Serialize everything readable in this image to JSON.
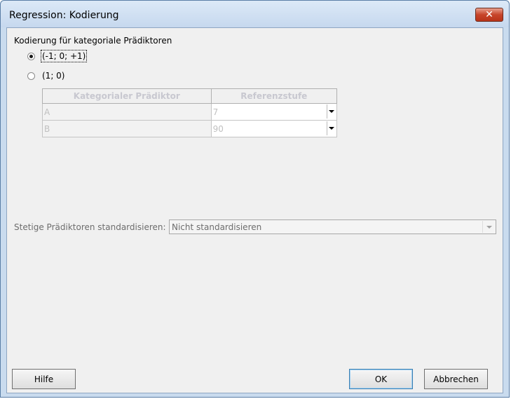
{
  "window": {
    "title": "Regression: Kodierung",
    "close_glyph": "✕"
  },
  "coding": {
    "group_label": "Kodierung für kategoriale Prädiktoren",
    "options": [
      {
        "label": "(-1; 0; +1)",
        "checked": true
      },
      {
        "label": "(1; 0)",
        "checked": false
      }
    ]
  },
  "grid": {
    "headers": [
      "Kategorialer Prädiktor",
      "Referenzstufe"
    ],
    "rows": [
      {
        "predictor": "A",
        "reference": "7"
      },
      {
        "predictor": "B",
        "reference": "90"
      }
    ]
  },
  "standardize": {
    "label": "Stetige Prädiktoren standardisieren:",
    "value": "Nicht standardisieren"
  },
  "buttons": {
    "help": "Hilfe",
    "ok": "OK",
    "cancel": "Abbrechen"
  }
}
